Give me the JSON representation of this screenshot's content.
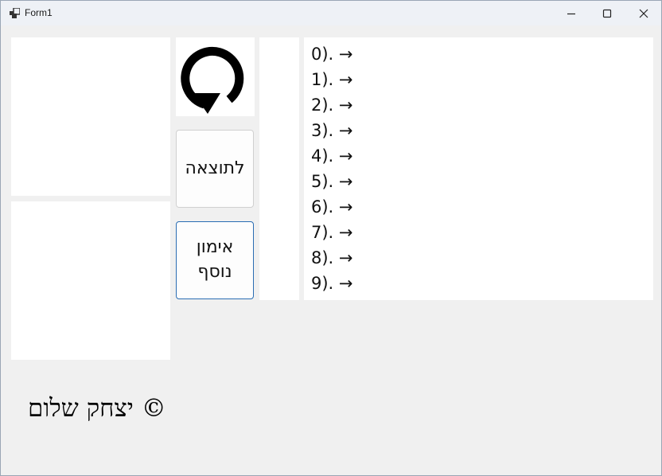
{
  "window": {
    "title": "Form1",
    "minimize_icon": "minimize-icon",
    "maximize_icon": "maximize-icon",
    "close_icon": "close-icon"
  },
  "buttons": {
    "reset_icon": "rotate-ccw-arrow-icon",
    "to_result": "לתוצאה",
    "more_training_line1": "אימון",
    "more_training_line2": "נוסף"
  },
  "results": [
    "0). →",
    "1). →",
    "2). →",
    "3). →",
    "4). →",
    "5). →",
    "6). →",
    "7). →",
    "8). →",
    "9). →"
  ],
  "footer": {
    "copyright": "© יצחק שלום"
  },
  "colors": {
    "background": "#f0f0f0",
    "panel": "#ffffff",
    "focus_border": "#2a6db3"
  }
}
